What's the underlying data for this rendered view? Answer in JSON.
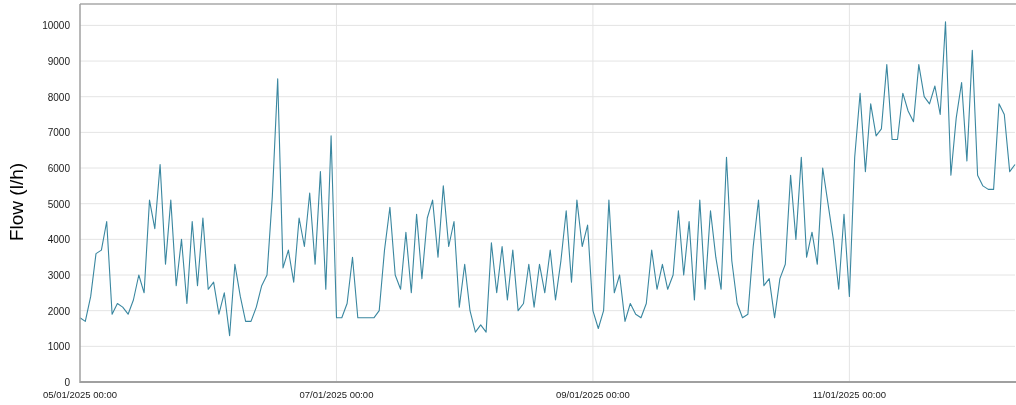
{
  "chart_data": {
    "type": "line",
    "ylabel": "Flow (l/h)",
    "grid": true,
    "ylim": [
      0,
      10600
    ],
    "yticks": [
      0,
      1000,
      2000,
      3000,
      4000,
      5000,
      6000,
      7000,
      8000,
      9000,
      10000
    ],
    "categories": [
      "05/01/2025 00:00",
      null,
      null,
      null,
      null,
      null,
      null,
      null,
      null,
      null,
      null,
      null,
      null,
      null,
      null,
      null,
      null,
      null,
      null,
      null,
      null,
      null,
      null,
      null,
      null,
      null,
      null,
      null,
      null,
      null,
      null,
      null,
      null,
      null,
      null,
      null,
      null,
      null,
      null,
      null,
      null,
      null,
      null,
      null,
      null,
      null,
      null,
      null,
      "07/01/2025 00:00",
      null,
      null,
      null,
      null,
      null,
      null,
      null,
      null,
      null,
      null,
      null,
      null,
      null,
      null,
      null,
      null,
      null,
      null,
      null,
      null,
      null,
      null,
      null,
      null,
      null,
      null,
      null,
      null,
      null,
      null,
      null,
      null,
      null,
      null,
      null,
      null,
      null,
      null,
      null,
      null,
      null,
      null,
      null,
      null,
      null,
      null,
      null,
      "09/01/2025 00:00",
      null,
      null,
      null,
      null,
      null,
      null,
      null,
      null,
      null,
      null,
      null,
      null,
      null,
      null,
      null,
      null,
      null,
      null,
      null,
      null,
      null,
      null,
      null,
      null,
      null,
      null,
      null,
      null,
      null,
      null,
      null,
      null,
      null,
      null,
      null,
      null,
      null,
      null,
      null,
      null,
      null,
      null,
      null,
      null,
      null,
      null,
      null,
      "11/01/2025 00:00",
      null,
      null,
      null,
      null,
      null,
      null,
      null,
      null,
      null,
      null,
      null,
      null,
      null,
      null,
      null,
      null,
      null,
      null,
      null,
      null,
      null,
      null,
      null,
      null,
      null,
      null,
      null,
      null,
      null,
      null,
      null
    ],
    "series": [
      {
        "color": "#3a87a0",
        "values": [
          1800,
          1700,
          2400,
          3600,
          3700,
          4500,
          1900,
          2200,
          2100,
          1900,
          2300,
          3000,
          2500,
          5100,
          4300,
          6100,
          3300,
          5100,
          2700,
          4000,
          2200,
          4500,
          2700,
          4600,
          2600,
          2800,
          1900,
          2500,
          1300,
          3300,
          2400,
          1700,
          1700,
          2100,
          2700,
          3000,
          5200,
          8500,
          3200,
          3700,
          2800,
          4600,
          3800,
          5300,
          3300,
          5900,
          2600,
          6900,
          1800,
          1800,
          2200,
          3500,
          1800,
          1800,
          1800,
          1800,
          2000,
          3700,
          4900,
          3000,
          2600,
          4200,
          2500,
          4700,
          2900,
          4600,
          5100,
          3500,
          5500,
          3800,
          4500,
          2100,
          3300,
          2000,
          1400,
          1600,
          1400,
          3900,
          2500,
          3800,
          2300,
          3700,
          2000,
          2200,
          3300,
          2100,
          3300,
          2500,
          3700,
          2300,
          3400,
          4800,
          2800,
          5100,
          3800,
          4400,
          2000,
          1500,
          2000,
          5100,
          2500,
          3000,
          1700,
          2200,
          1900,
          1800,
          2200,
          3700,
          2600,
          3300,
          2600,
          3000,
          4800,
          3000,
          4500,
          2300,
          5100,
          2600,
          4800,
          3500,
          2600,
          6300,
          3400,
          2200,
          1800,
          1900,
          3800,
          5100,
          2700,
          2900,
          1800,
          2900,
          3300,
          5800,
          4000,
          6300,
          3500,
          4200,
          3300,
          6000,
          5000,
          4000,
          2600,
          4700,
          2400,
          6300,
          8100,
          5900,
          7800,
          6900,
          7100,
          8900,
          6800,
          6800,
          8100,
          7600,
          7300,
          8900,
          8000,
          7800,
          8300,
          7500,
          10100,
          5800,
          7400,
          8400,
          6200,
          9300,
          5800,
          5500,
          5400,
          5400,
          7800,
          7500,
          5900,
          6100
        ]
      }
    ]
  }
}
